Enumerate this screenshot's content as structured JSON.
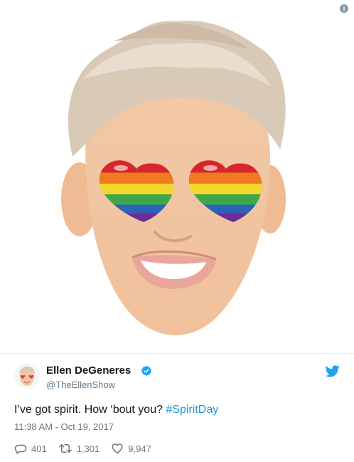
{
  "media": {
    "icon": "info-icon",
    "illustration": "ellen-emoji-rainbow-heart-eyes"
  },
  "tweet": {
    "author_name": "Ellen DeGeneres",
    "author_handle": "@TheEllenShow",
    "text_prefix": "I’ve got spirit. How ‘bout you? ",
    "hashtag": "#SpiritDay",
    "timestamp": "11:38 AM - Oct 19, 2017",
    "verified": true
  },
  "actions": {
    "reply_count": "401",
    "retweet_count": "1,301",
    "like_count": "9,947"
  },
  "colors": {
    "link": "#1b95e0",
    "secondary_text": "#657786",
    "primary_text": "#14171a",
    "twitter_blue": "#1da1f2"
  }
}
